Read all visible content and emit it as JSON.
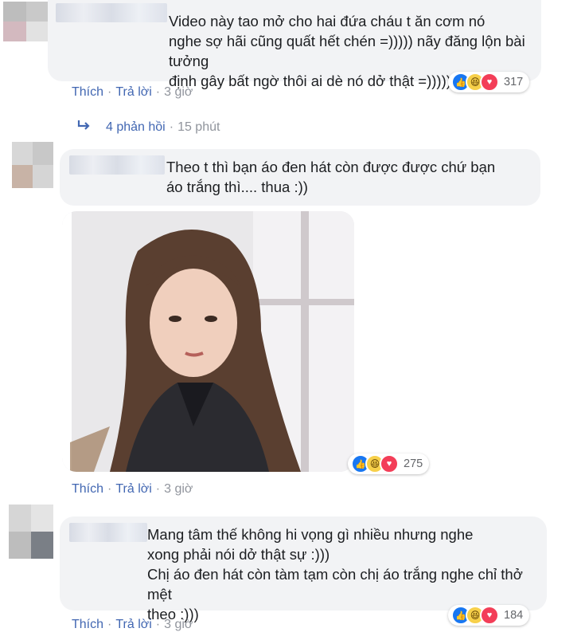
{
  "comments": [
    {
      "text": "Video này tao mở cho hai đứa cháu t ăn cơm nó\nnghe sợ hãi cũng quất hết chén =))))) nãy đăng lộn bài tưởng\nđịnh gây bất ngờ thôi ai dè nó dở thật =)))))",
      "reaction_count": "317",
      "actions": {
        "like": "Thích",
        "reply": "Trả lời",
        "time": "3 giờ"
      },
      "replies": {
        "label": "4 phản hồi",
        "time": "15 phút"
      }
    },
    {
      "text": "Theo t thì bạn áo đen hát còn được được chứ bạn\náo trắng thì.... thua :))",
      "reaction_count": "275",
      "actions": {
        "like": "Thích",
        "reply": "Trả lời",
        "time": "3 giờ"
      }
    },
    {
      "text": "Mang tâm thế không hi vọng gì nhiều nhưng nghe\nxong phải nói dở thật sự :)))\nChị áo đen hát còn tàm tạm còn chị áo trắng nghe chỉ thở mệt\ntheo :)))",
      "reaction_count": "184",
      "actions": {
        "like": "Thích",
        "reply": "Trả lời",
        "time": "3 giờ"
      }
    }
  ],
  "separator": "·",
  "reaction_icons": [
    "like-icon",
    "haha-icon",
    "love-icon"
  ],
  "colors": {
    "link": "#4267b2",
    "meta": "#90949c",
    "bubble": "#f2f3f5",
    "like": "#1877f2",
    "love": "#f33e58",
    "haha": "#f7d04a"
  }
}
